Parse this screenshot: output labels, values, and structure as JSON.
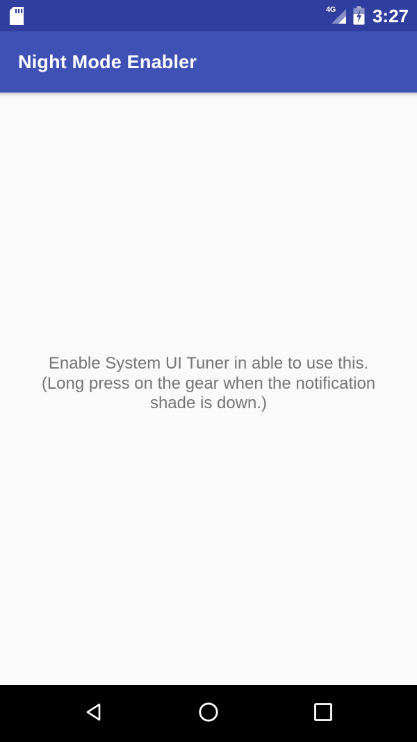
{
  "status_bar": {
    "time": "3:27",
    "network_type": "4G",
    "icons": {
      "storage": "sd-card-icon",
      "signal": "signal-4g-icon",
      "battery": "battery-charging-icon"
    },
    "background_color": "#303f9f",
    "foreground_color": "#ffffff"
  },
  "app_bar": {
    "title": "Night Mode Enabler",
    "background_color": "#3f51b5",
    "title_color": "#ffffff"
  },
  "content": {
    "background_color": "#fafafa",
    "message": "Enable System UI Tuner in able to use this. (Long press on the gear when the notification shade is down.)",
    "message_color": "#757575"
  },
  "nav_bar": {
    "background_color": "#000000",
    "buttons": [
      {
        "name": "back",
        "icon": "back-triangle-icon"
      },
      {
        "name": "home",
        "icon": "home-circle-icon"
      },
      {
        "name": "recents",
        "icon": "recents-square-icon"
      }
    ]
  }
}
